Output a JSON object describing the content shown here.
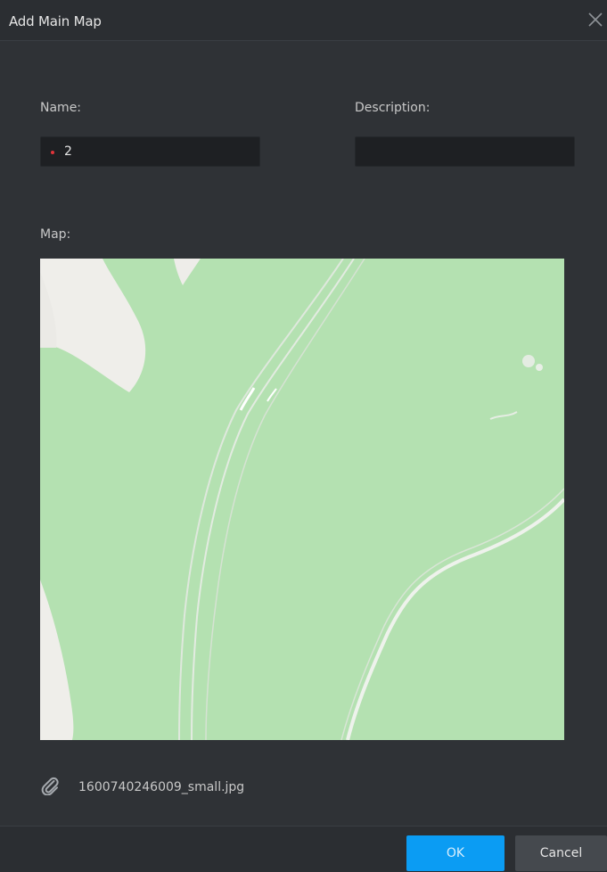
{
  "dialog": {
    "title": "Add Main Map"
  },
  "form": {
    "name_label": "Name:",
    "name_value": "2",
    "description_label": "Description:",
    "description_value": "",
    "map_label": "Map:"
  },
  "attachment": {
    "file_name": "1600740246009_small.jpg"
  },
  "footer": {
    "ok_label": "OK",
    "cancel_label": "Cancel"
  },
  "colors": {
    "dialog_bg": "#2f3236",
    "input_bg": "#1e2023",
    "accent": "#0b9cf3",
    "required": "#e0343a",
    "map_land": "#b4e1b1"
  },
  "icons": {
    "close": "close-icon",
    "attachment": "paperclip-icon"
  }
}
